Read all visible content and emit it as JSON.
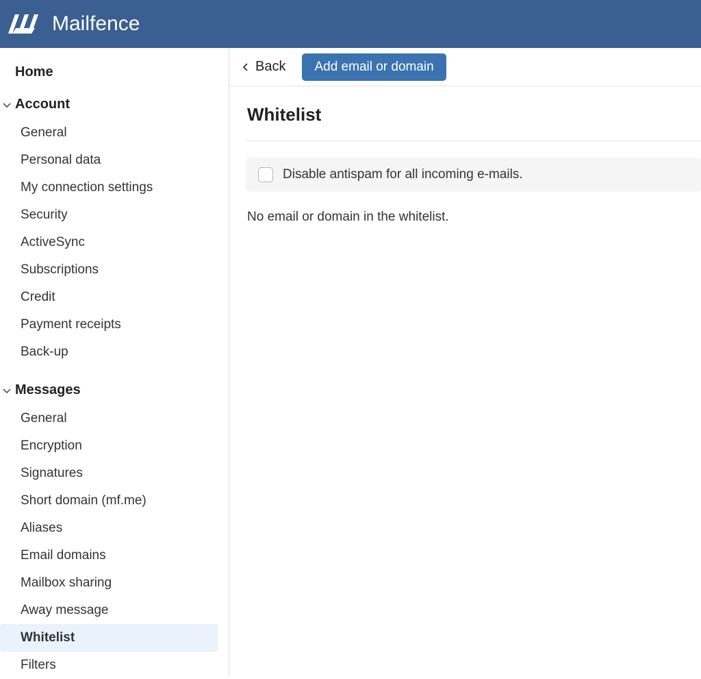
{
  "brand": {
    "name": "Mailfence"
  },
  "sidebar": {
    "home": "Home",
    "sections": [
      {
        "label": "Account",
        "items": [
          "General",
          "Personal data",
          "My connection settings",
          "Security",
          "ActiveSync",
          "Subscriptions",
          "Credit",
          "Payment receipts",
          "Back-up"
        ]
      },
      {
        "label": "Messages",
        "items": [
          "General",
          "Encryption",
          "Signatures",
          "Short domain (mf.me)",
          "Aliases",
          "Email domains",
          "Mailbox sharing",
          "Away message",
          "Whitelist",
          "Filters"
        ]
      }
    ]
  },
  "toolbar": {
    "back": "Back",
    "add": "Add email or domain"
  },
  "page": {
    "title": "Whitelist",
    "disable_label": "Disable antispam for all incoming e-mails.",
    "empty": "No email or domain in the whitelist."
  },
  "colors": {
    "accent": "#3b72b0",
    "header": "#3b5f91"
  }
}
